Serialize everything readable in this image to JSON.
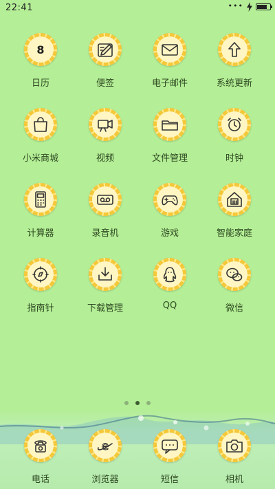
{
  "status": {
    "time": "22:41",
    "battery_level": 0.8
  },
  "apps": [
    {
      "label": "日历",
      "icon": "calendar-icon",
      "badge_text": "8"
    },
    {
      "label": "便签",
      "icon": "notes-icon"
    },
    {
      "label": "电子邮件",
      "icon": "email-icon"
    },
    {
      "label": "系统更新",
      "icon": "update-icon"
    },
    {
      "label": "小米商城",
      "icon": "shopping-bag-icon"
    },
    {
      "label": "视频",
      "icon": "video-camera-icon"
    },
    {
      "label": "文件管理",
      "icon": "folder-icon"
    },
    {
      "label": "时钟",
      "icon": "alarm-clock-icon"
    },
    {
      "label": "计算器",
      "icon": "calculator-icon"
    },
    {
      "label": "录音机",
      "icon": "recorder-icon"
    },
    {
      "label": "游戏",
      "icon": "gamepad-icon"
    },
    {
      "label": "智能家庭",
      "icon": "smart-home-icon"
    },
    {
      "label": "指南针",
      "icon": "compass-icon"
    },
    {
      "label": "下载管理",
      "icon": "download-icon"
    },
    {
      "label": "QQ",
      "icon": "qq-penguin-icon"
    },
    {
      "label": "微信",
      "icon": "wechat-icon"
    }
  ],
  "page_indicator": {
    "count": 3,
    "active_index": 1
  },
  "dock": [
    {
      "label": "电话",
      "icon": "phone-icon"
    },
    {
      "label": "浏览器",
      "icon": "browser-icon"
    },
    {
      "label": "短信",
      "icon": "messages-icon"
    },
    {
      "label": "相机",
      "icon": "camera-icon"
    }
  ],
  "colors": {
    "background": "#b4ee96",
    "icon_rim": "#f5c83a",
    "label": "#2f4a23"
  }
}
